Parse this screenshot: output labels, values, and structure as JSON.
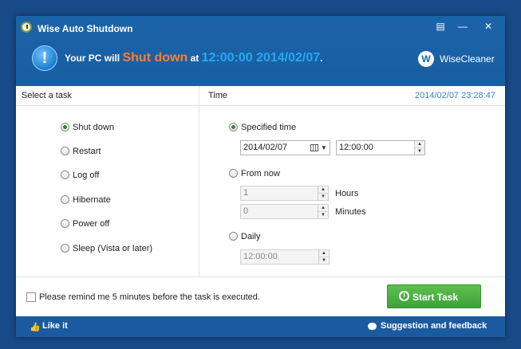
{
  "window": {
    "title": "Wise Auto Shutdown",
    "controls": {
      "menu_icon": "menu-icon",
      "minimize_icon": "minimize-icon",
      "close_icon": "close-icon"
    }
  },
  "status": {
    "prefix": "Your PC will",
    "action": "Shut down",
    "at": "at",
    "time": "12:00:00 2014/02/07",
    "suffix": ".",
    "colors": {
      "action": "#ff7f27",
      "time": "#23aaf0"
    }
  },
  "brand": {
    "name": "WiseCleaner",
    "logo_letter": "W"
  },
  "headers": {
    "task": "Select a task",
    "time": "Time",
    "now": "2014/02/07 23:28:47"
  },
  "tasks": [
    {
      "label": "Shut down",
      "selected": true
    },
    {
      "label": "Restart",
      "selected": false
    },
    {
      "label": "Log off",
      "selected": false
    },
    {
      "label": "Hibernate",
      "selected": false
    },
    {
      "label": "Power off",
      "selected": false
    },
    {
      "label": "Sleep (Vista or later)",
      "selected": false
    }
  ],
  "time_options": {
    "specified": {
      "label": "Specified time",
      "selected": true,
      "date": "2014/02/07",
      "time": "12:00:00"
    },
    "from_now": {
      "label": "From now",
      "selected": false,
      "hours": "1",
      "hours_unit": "Hours",
      "minutes": "0",
      "minutes_unit": "Minutes"
    },
    "daily": {
      "label": "Daily",
      "selected": false,
      "time": "12:00:00"
    }
  },
  "remind": {
    "label": "Please remind me 5 minutes before the task is executed.",
    "checked": false
  },
  "start_button": {
    "label": "Start Task"
  },
  "footer": {
    "like": "Like it",
    "feedback": "Suggestion and feedback"
  }
}
